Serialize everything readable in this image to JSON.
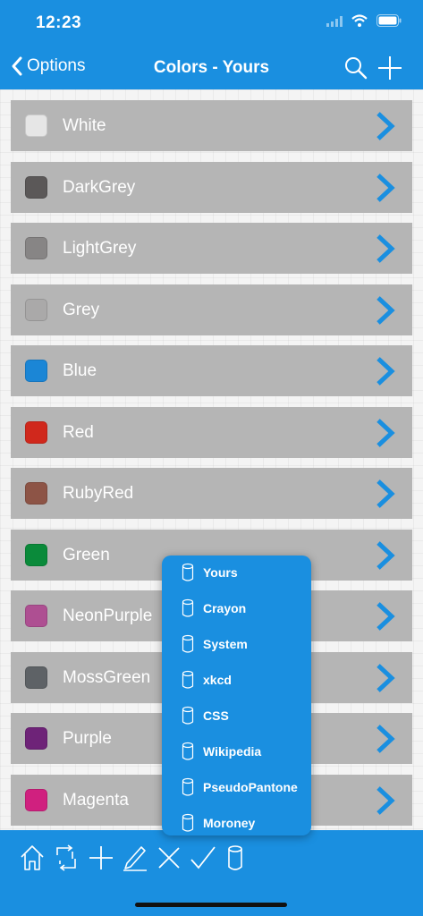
{
  "status_bar": {
    "time": "12:23",
    "icons": [
      "signal-icon",
      "wifi-icon",
      "battery-icon"
    ]
  },
  "nav": {
    "back_label": "Options",
    "title": "Colors - Yours",
    "actions": [
      "search-icon",
      "plus-icon"
    ]
  },
  "colors": [
    {
      "name": "White",
      "swatch": "#e6e6e6"
    },
    {
      "name": "DarkGrey",
      "swatch": "#5b5858"
    },
    {
      "name": "LightGrey",
      "swatch": "#878585"
    },
    {
      "name": "Grey",
      "swatch": "#aaa9a9"
    },
    {
      "name": "Blue",
      "swatch": "#1b86d6"
    },
    {
      "name": "Red",
      "swatch": "#d0281c"
    },
    {
      "name": "RubyRed",
      "swatch": "#8d5446"
    },
    {
      "name": "Green",
      "swatch": "#0a8a3a"
    },
    {
      "name": "NeonPurple",
      "swatch": "#ae4f92"
    },
    {
      "name": "MossGreen",
      "swatch": "#5e6266"
    },
    {
      "name": "Purple",
      "swatch": "#6e2378"
    },
    {
      "name": "Magenta",
      "swatch": "#d0207f"
    }
  ],
  "source_menu": [
    "Yours",
    "Crayon",
    "System",
    "xkcd",
    "CSS",
    "Wikipedia",
    "PseudoPantone",
    "Moroney"
  ],
  "toolbar": [
    "home-icon",
    "swap-icon",
    "plus-icon",
    "pencil-icon",
    "close-icon",
    "check-icon",
    "database-icon"
  ],
  "theme": {
    "accent": "#1a8fe0",
    "row_bg": "#b5b5b5",
    "chevron": "#1a8fe0"
  }
}
